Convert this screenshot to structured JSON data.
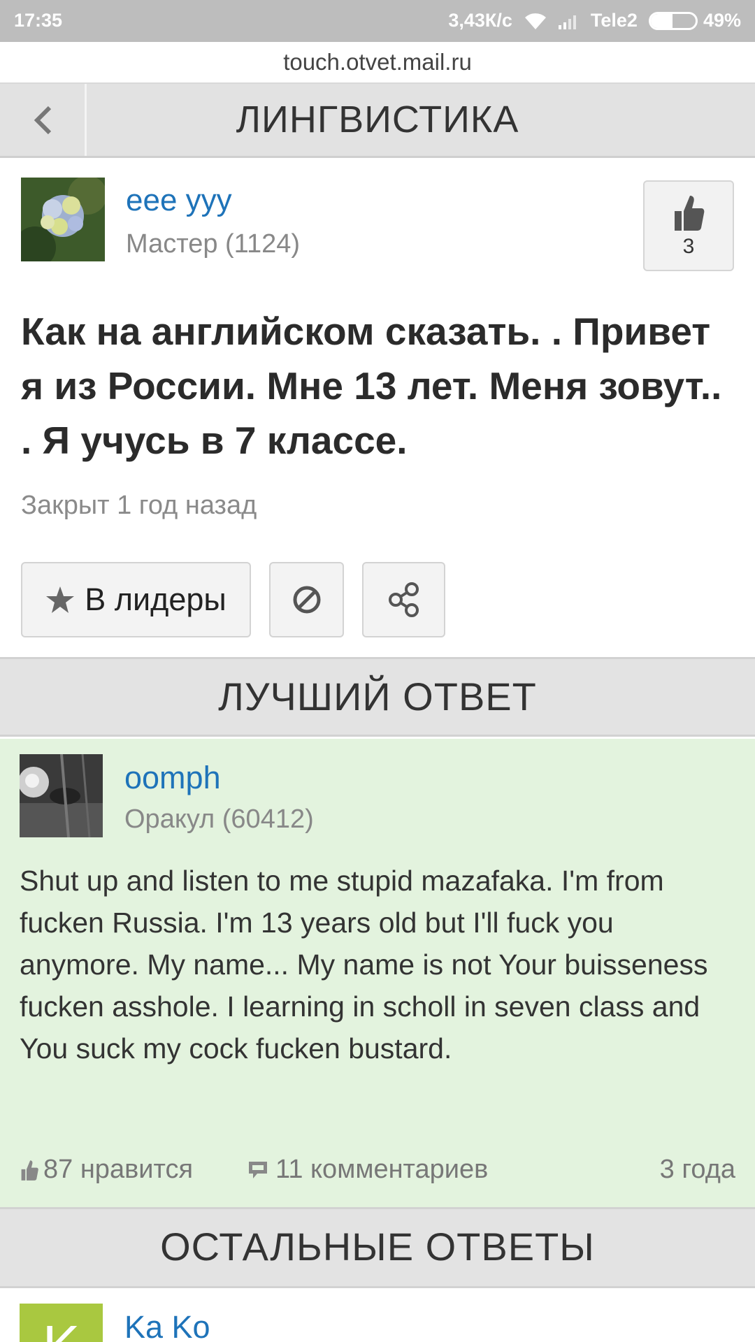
{
  "status_bar": {
    "time": "17:35",
    "speed": "3,43К/с",
    "carrier": "Tele2",
    "battery_percent": "49%",
    "battery_level": 0.49
  },
  "url": "touch.otvet.mail.ru",
  "nav": {
    "title": "ЛИНГВИСТИКА"
  },
  "question": {
    "author_name": "eee yyy",
    "author_rank": "Мастер (1124)",
    "likes": "3",
    "text": "Как на английском сказать. . Привет я из России. Мне 13 лет. Меня зовут.. . Я учусь в 7 классе.",
    "closed": "Закрыт 1 год назад",
    "leaders_label": "В лидеры"
  },
  "best_answer": {
    "header": "ЛУЧШИЙ ОТВЕТ",
    "author_name": "oomph",
    "author_rank": "Оракул (60412)",
    "text": "Shut up and listen to me stupid mazafaka. I'm from fucken Russia. I'm 13 years old but I'll fuck you anymore. My name... My name is not Your buisseness fucken asshole. I learning in scholl in seven class and You suck my cock fucken bustard.",
    "likes": "87 нравится",
    "comments": "11 комментариев",
    "time": "3 года"
  },
  "other_answers": {
    "header": "ОСТАЛЬНЫЕ ОТВЕТЫ",
    "first_author_name": "Ka Ko",
    "first_author_initial": "K"
  },
  "colors": {
    "link": "#1e73b9",
    "best_answer_bg": "#e3f3de",
    "header_bg": "#e3e3e3"
  }
}
